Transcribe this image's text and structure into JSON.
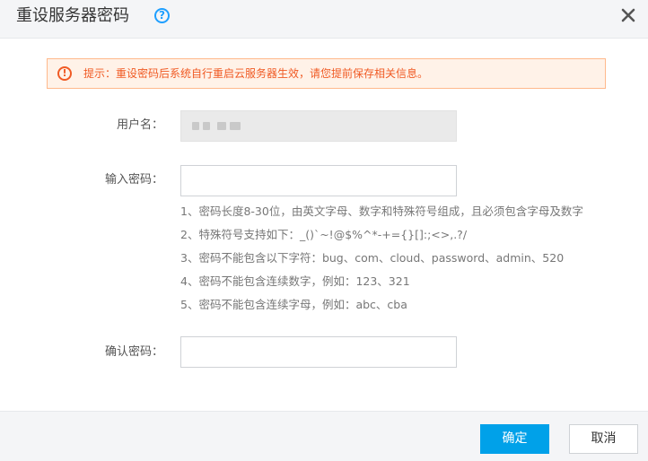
{
  "dialog": {
    "title": "重设服务器密码",
    "help_icon": "?",
    "close_icon": "close-icon"
  },
  "notice": {
    "icon": "!",
    "text": "提示：重设密码后系统自行重启云服务器生效，请您提前保存相关信息。"
  },
  "form": {
    "username_label": "用户名：",
    "password_label": "输入密码：",
    "confirm_label": "确认密码：",
    "rules": [
      "1、密码长度8-30位，由英文字母、数字和特殊符号组成，且必须包含字母及数字",
      "2、特殊符号支持如下：_()`~!@$%^*-+={}[]:;<>,.?/",
      "3、密码不能包含以下字符：bug、com、cloud、password、admin、520",
      "4、密码不能包含连续数字，例如：123、321",
      "5、密码不能包含连续字母，例如：abc、cba"
    ]
  },
  "footer": {
    "ok_label": "确定",
    "cancel_label": "取消"
  },
  "colors": {
    "accent": "#00a1e9",
    "help": "#1e9fff",
    "warning": "#f05a24",
    "warning_bg": "#fff2e8"
  }
}
